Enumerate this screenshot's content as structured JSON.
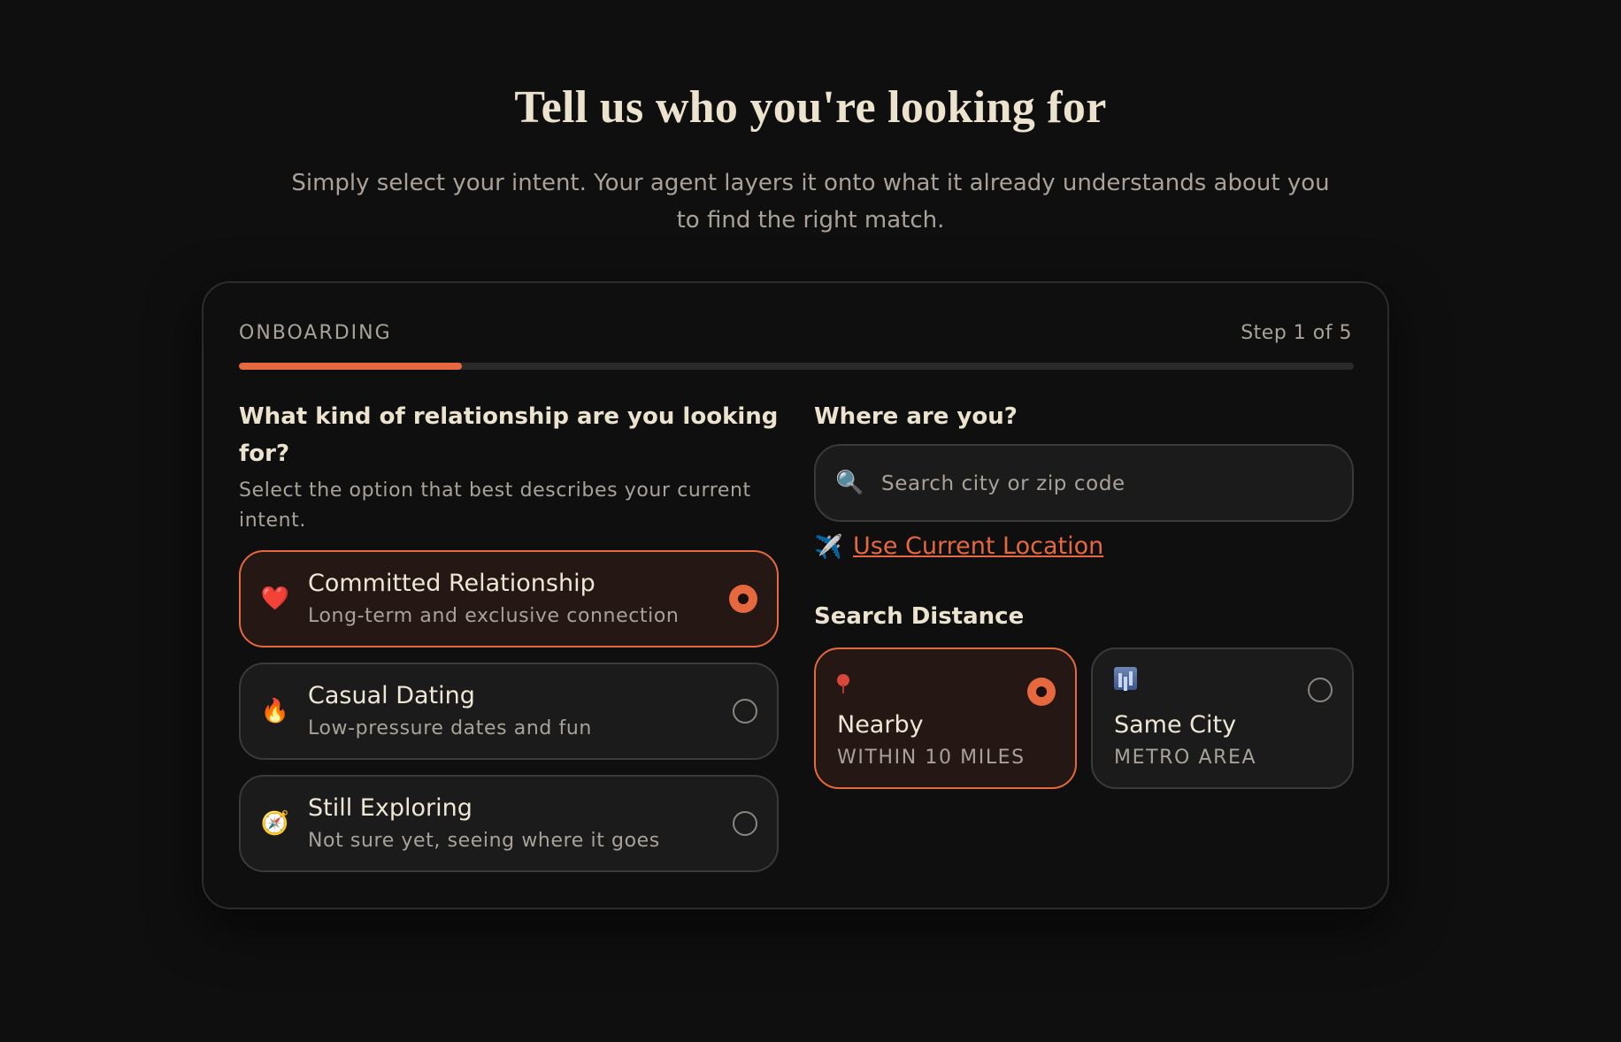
{
  "hero": {
    "title": "Tell us who you're looking for",
    "subtitle": "Simply select your intent. Your agent layers it onto what it already understands about you to find the right match."
  },
  "card": {
    "section_label": "ONBOARDING",
    "step_label": "Step 1 of 5",
    "progress_fraction": 0.2,
    "accent_color": "#e5683e"
  },
  "relationship": {
    "question": "What kind of relationship are you looking for?",
    "hint": "Select the option that best describes your current intent.",
    "options": [
      {
        "icon": "heart-icon",
        "glyph": "❤️",
        "title": "Committed Relationship",
        "subtitle": "Long-term and exclusive connection",
        "selected": true
      },
      {
        "icon": "fire-icon",
        "glyph": "🔥",
        "title": "Casual Dating",
        "subtitle": "Low-pressure dates and fun",
        "selected": false
      },
      {
        "icon": "compass-icon",
        "glyph": "🧭",
        "title": "Still Exploring",
        "subtitle": "Not sure yet, seeing where it goes",
        "selected": false
      }
    ]
  },
  "location": {
    "question": "Where are you?",
    "search_icon": "🔍",
    "search_placeholder": "Search city or zip code",
    "search_value": "",
    "current_location_icon": "✈️",
    "current_location_label": "Use Current Location"
  },
  "distance": {
    "title": "Search Distance",
    "options": [
      {
        "icon": "pin-icon",
        "title": "Nearby",
        "subtitle": "WITHIN 10 MILES",
        "selected": true
      },
      {
        "icon": "city-icon",
        "title": "Same City",
        "subtitle": "METRO AREA",
        "selected": false
      }
    ]
  }
}
